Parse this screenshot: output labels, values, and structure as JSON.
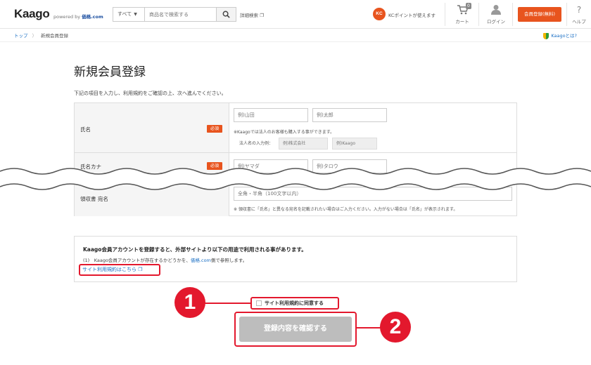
{
  "header": {
    "logo": "Kaago",
    "powered_prefix": "powered by",
    "powered_brand": "価格.com",
    "search_category": "すべて",
    "search_placeholder": "商品名で検索する",
    "advanced_search": "詳細検索",
    "kc_badge": "KC",
    "kc_text": "KCポイントが使えます",
    "cart_label": "カート",
    "cart_count": "0",
    "login_label": "ログイン",
    "signup_label": "会員登録(無料)",
    "help_label": "ヘルプ"
  },
  "breadcrumb": {
    "home": "トップ",
    "current": "新規会員登録"
  },
  "kaago_what": "Kaagoとは?",
  "page_title": "新規会員登録",
  "intro": "下記の項目を入力し、利用規約をご確認の上、次へ進んでください。",
  "required_badge": "必須",
  "form": {
    "name": {
      "label": "氏名",
      "last_placeholder": "例)山田",
      "first_placeholder": "例)太郎",
      "note": "※Kaagoでは法人のお客様も購入する事ができます。",
      "corp_label": "法人名の入力例：",
      "corp_example1": "例)株式会社",
      "corp_example2": "例)Kaago"
    },
    "kana": {
      "label": "氏名カナ",
      "last_placeholder": "例)ヤマダ",
      "first_placeholder": "例)タロウ"
    },
    "receipt": {
      "label": "領収書 宛名",
      "placeholder": "全角・半角（100文字以内）",
      "note": "※ 領収書に「氏名」と異なる宛名を記載されたい場合はご入力ください。入力がない場合は「氏名」が表示されます。"
    }
  },
  "notice": {
    "title": "Kaago会員アカウントを登録すると、外部サイトより以下の用途で利用される事があります。",
    "line_prefix": "(1)　Kaago会員アカウントが存在するかどうかを、",
    "line_link": "価格.com",
    "line_suffix": "側で参照します。",
    "terms_link": "サイト利用規約はこちら"
  },
  "agree_label": "サイト利用規約に同意する",
  "submit_label": "登録内容を確認する",
  "callouts": {
    "one": "1",
    "two": "2"
  },
  "colors": {
    "accent": "#e8541e",
    "annotation": "#e3182d",
    "link": "#1a6fc4",
    "disabled": "#bdbdbd"
  }
}
